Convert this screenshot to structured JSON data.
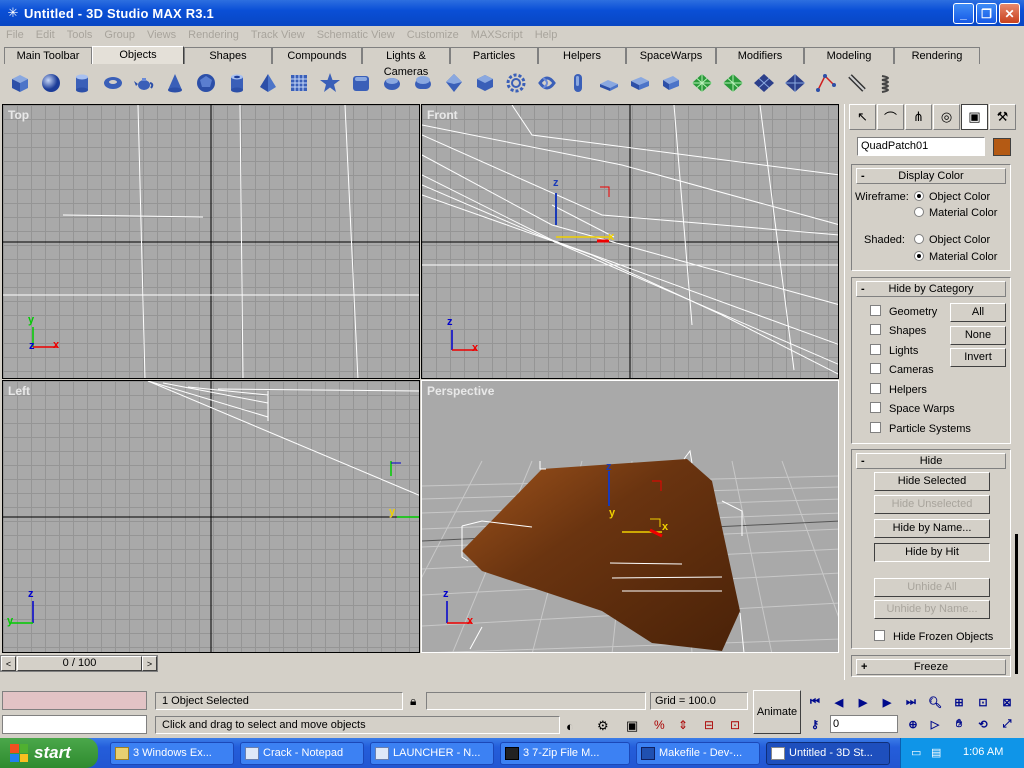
{
  "window": {
    "title": "Untitled - 3D Studio MAX R3.1",
    "minimize": "_",
    "maximize": "❐",
    "close": "✕"
  },
  "menu": [
    "File",
    "Edit",
    "Tools",
    "Group",
    "Views",
    "Rendering",
    "Track View",
    "Schematic View",
    "Customize",
    "MAXScript",
    "Help"
  ],
  "tabs": [
    {
      "label": "Main Toolbar"
    },
    {
      "label": "Objects",
      "active": true
    },
    {
      "label": "Shapes"
    },
    {
      "label": "Compounds"
    },
    {
      "label": "Lights & Cameras"
    },
    {
      "label": "Particles"
    },
    {
      "label": "Helpers"
    },
    {
      "label": "SpaceWarps"
    },
    {
      "label": "Modifiers"
    },
    {
      "label": "Modeling"
    },
    {
      "label": "Rendering"
    }
  ],
  "toolbar_icons": [
    "box-icon",
    "sphere-icon",
    "cylinder-icon",
    "torus-icon",
    "teapot-icon",
    "cone-icon",
    "geosphere-icon",
    "tube-icon",
    "pyramid-icon",
    "grid-plane-icon",
    "star-icon",
    "chamfer-box-icon",
    "capsule-icon",
    "oil-tank-icon",
    "gem-icon",
    "hedra-icon",
    "gear-icon",
    "torus-knot-icon",
    "pill-icon",
    "l-ext-icon",
    "c-ext-icon",
    "prism-icon",
    "quad-patch-icon",
    "tri-patch-icon",
    "nurbs-surface-icon",
    "nurbs-point-surface-icon",
    "nurbs-curve-icon",
    "bone-icon",
    "spring-icon"
  ],
  "viewports": {
    "top": {
      "label": "Top"
    },
    "front": {
      "label": "Front"
    },
    "left": {
      "label": "Left"
    },
    "perspective": {
      "label": "Perspective"
    }
  },
  "axes": {
    "x": "x",
    "y": "y",
    "z": "z"
  },
  "command_panel": {
    "tabs": [
      "create-tab-icon",
      "modify-tab-icon",
      "hierarchy-tab-icon",
      "motion-tab-icon",
      "display-tab-icon",
      "utilities-tab-icon"
    ],
    "object_name": "QuadPatch01",
    "object_color": "#b45a14",
    "display_color": {
      "title": "Display Color",
      "wireframe_label": "Wireframe:",
      "shaded_label": "Shaded:",
      "object_color": "Object Color",
      "material_color": "Material Color",
      "wireframe_value": "Object Color",
      "shaded_value": "Material Color"
    },
    "hide_by_category": {
      "title": "Hide by Category",
      "items": [
        "Geometry",
        "Shapes",
        "Lights",
        "Cameras",
        "Helpers",
        "Space Warps",
        "Particle Systems"
      ],
      "buttons": [
        "All",
        "None",
        "Invert"
      ]
    },
    "hide": {
      "title": "Hide",
      "buttons": [
        {
          "label": "Hide Selected",
          "enabled": true
        },
        {
          "label": "Hide Unselected",
          "enabled": false
        },
        {
          "label": "Hide by Name...",
          "enabled": true
        },
        {
          "label": "Hide by Hit",
          "enabled": true
        },
        {
          "label": "Unhide All",
          "enabled": false
        },
        {
          "label": "Unhide by Name...",
          "enabled": false
        }
      ],
      "hide_frozen": "Hide Frozen Objects"
    },
    "freeze": {
      "title": "Freeze"
    }
  },
  "time_slider": {
    "value": "0 / 100"
  },
  "status": {
    "selection": "1 Object Selected",
    "prompt": "Click and drag to select and move objects",
    "grid": "Grid = 100.0",
    "animate": "Animate",
    "frame": "0"
  },
  "taskbar": {
    "start": "start",
    "items": [
      {
        "label": "3 Windows Ex...",
        "active": false
      },
      {
        "label": "Crack - Notepad",
        "active": false
      },
      {
        "label": "LAUNCHER - N...",
        "active": false
      },
      {
        "label": "3 7-Zip File M...",
        "active": false
      },
      {
        "label": "Makefile - Dev-...",
        "active": false
      },
      {
        "label": "Untitled - 3D St...",
        "active": true
      }
    ],
    "clock": "1:06 AM"
  }
}
